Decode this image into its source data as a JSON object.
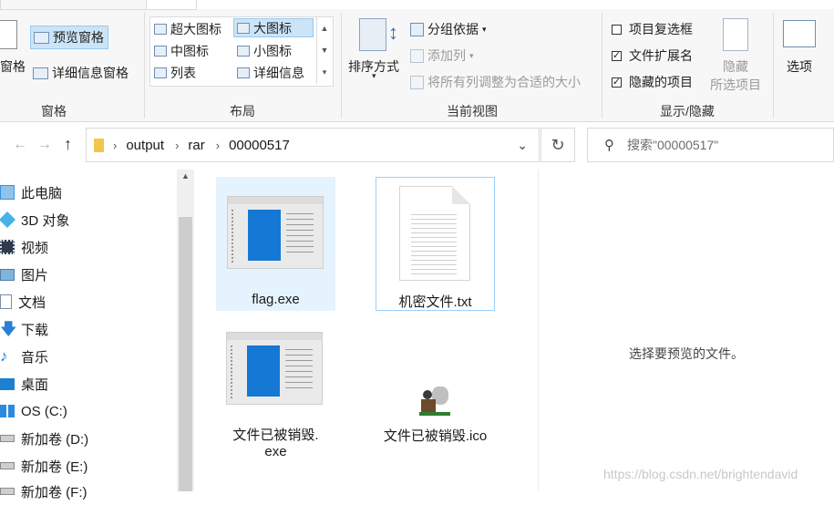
{
  "ribbon": {
    "pane_group": {
      "title": "窗格",
      "nav_pane_label": "窗格",
      "preview_pane": "预览窗格",
      "details_pane": "详细信息窗格"
    },
    "layout_group": {
      "title": "布局",
      "items": [
        {
          "label": "超大图标",
          "selected": false
        },
        {
          "label": "大图标",
          "selected": true
        },
        {
          "label": "中图标",
          "selected": false
        },
        {
          "label": "小图标",
          "selected": false
        },
        {
          "label": "列表",
          "selected": false
        },
        {
          "label": "详细信息",
          "selected": false
        }
      ]
    },
    "current_view_group": {
      "title": "当前视图",
      "sort_by": "排序方式",
      "group_by": "分组依据",
      "add_column": "添加列",
      "fit_columns": "将所有列调整为合适的大小"
    },
    "show_hide_group": {
      "title": "显示/隐藏",
      "item_checkboxes": {
        "label": "项目复选框",
        "checked": false
      },
      "file_extensions": {
        "label": "文件扩展名",
        "checked": true
      },
      "hidden_items": {
        "label": "隐藏的项目",
        "checked": true
      },
      "hide_selected_line1": "隐藏",
      "hide_selected_line2": "所选项目"
    },
    "options_label": "选项"
  },
  "address": {
    "crumbs": [
      "output",
      "rar",
      "00000517"
    ],
    "search_placeholder": "搜索\"00000517\""
  },
  "nav_pane": {
    "items": [
      {
        "label": "此电脑",
        "icon": "this-pc-icon"
      },
      {
        "label": "3D 对象",
        "icon": "3d-objects-icon"
      },
      {
        "label": "视频",
        "icon": "videos-icon"
      },
      {
        "label": "图片",
        "icon": "pictures-icon"
      },
      {
        "label": "文档",
        "icon": "documents-icon"
      },
      {
        "label": "下载",
        "icon": "downloads-icon"
      },
      {
        "label": "音乐",
        "icon": "music-icon"
      },
      {
        "label": "桌面",
        "icon": "desktop-icon"
      },
      {
        "label": "OS (C:)",
        "icon": "windows-drive-icon"
      },
      {
        "label": "新加卷 (D:)",
        "icon": "drive-icon"
      },
      {
        "label": "新加卷 (E:)",
        "icon": "drive-icon"
      },
      {
        "label": "新加卷 (F:)",
        "icon": "drive-icon"
      }
    ]
  },
  "files": [
    {
      "name": "flag.exe",
      "type": "exe",
      "selected": true
    },
    {
      "name": "机密文件.txt",
      "type": "txt",
      "focused": true
    },
    {
      "name_line1": "文件已被销毁.",
      "name_line2": "exe",
      "type": "exe"
    },
    {
      "name": "文件已被销毁.ico",
      "type": "ico"
    }
  ],
  "preview": {
    "message": "选择要预览的文件。"
  },
  "watermark": "https://blog.csdn.net/brightendavid",
  "colors": {
    "selection": "#cce4f7",
    "tile_selected": "#e5f3ff",
    "accent_blue": "#1478d4"
  }
}
